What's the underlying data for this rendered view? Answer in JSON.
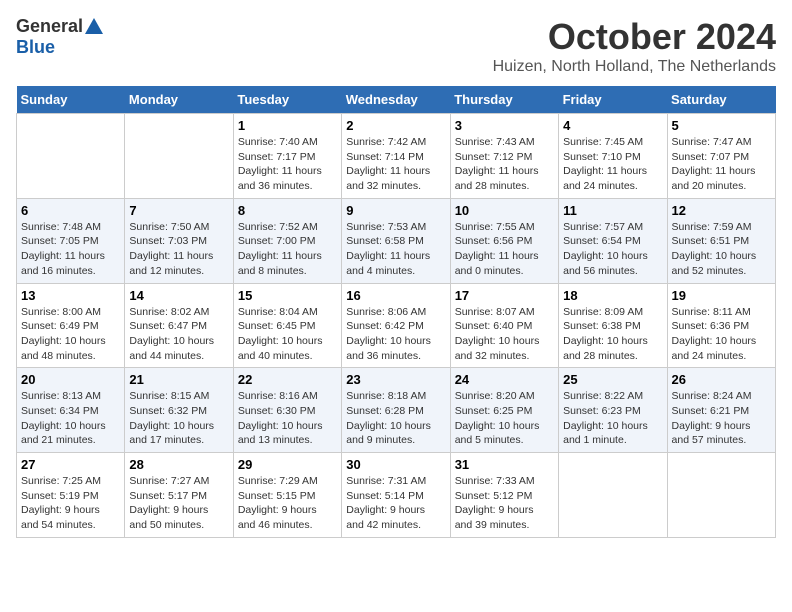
{
  "header": {
    "logo_general": "General",
    "logo_blue": "Blue",
    "title": "October 2024",
    "location": "Huizen, North Holland, The Netherlands"
  },
  "days_of_week": [
    "Sunday",
    "Monday",
    "Tuesday",
    "Wednesday",
    "Thursday",
    "Friday",
    "Saturday"
  ],
  "weeks": [
    [
      {
        "num": "",
        "detail": ""
      },
      {
        "num": "",
        "detail": ""
      },
      {
        "num": "1",
        "detail": "Sunrise: 7:40 AM\nSunset: 7:17 PM\nDaylight: 11 hours\nand 36 minutes."
      },
      {
        "num": "2",
        "detail": "Sunrise: 7:42 AM\nSunset: 7:14 PM\nDaylight: 11 hours\nand 32 minutes."
      },
      {
        "num": "3",
        "detail": "Sunrise: 7:43 AM\nSunset: 7:12 PM\nDaylight: 11 hours\nand 28 minutes."
      },
      {
        "num": "4",
        "detail": "Sunrise: 7:45 AM\nSunset: 7:10 PM\nDaylight: 11 hours\nand 24 minutes."
      },
      {
        "num": "5",
        "detail": "Sunrise: 7:47 AM\nSunset: 7:07 PM\nDaylight: 11 hours\nand 20 minutes."
      }
    ],
    [
      {
        "num": "6",
        "detail": "Sunrise: 7:48 AM\nSunset: 7:05 PM\nDaylight: 11 hours\nand 16 minutes."
      },
      {
        "num": "7",
        "detail": "Sunrise: 7:50 AM\nSunset: 7:03 PM\nDaylight: 11 hours\nand 12 minutes."
      },
      {
        "num": "8",
        "detail": "Sunrise: 7:52 AM\nSunset: 7:00 PM\nDaylight: 11 hours\nand 8 minutes."
      },
      {
        "num": "9",
        "detail": "Sunrise: 7:53 AM\nSunset: 6:58 PM\nDaylight: 11 hours\nand 4 minutes."
      },
      {
        "num": "10",
        "detail": "Sunrise: 7:55 AM\nSunset: 6:56 PM\nDaylight: 11 hours\nand 0 minutes."
      },
      {
        "num": "11",
        "detail": "Sunrise: 7:57 AM\nSunset: 6:54 PM\nDaylight: 10 hours\nand 56 minutes."
      },
      {
        "num": "12",
        "detail": "Sunrise: 7:59 AM\nSunset: 6:51 PM\nDaylight: 10 hours\nand 52 minutes."
      }
    ],
    [
      {
        "num": "13",
        "detail": "Sunrise: 8:00 AM\nSunset: 6:49 PM\nDaylight: 10 hours\nand 48 minutes."
      },
      {
        "num": "14",
        "detail": "Sunrise: 8:02 AM\nSunset: 6:47 PM\nDaylight: 10 hours\nand 44 minutes."
      },
      {
        "num": "15",
        "detail": "Sunrise: 8:04 AM\nSunset: 6:45 PM\nDaylight: 10 hours\nand 40 minutes."
      },
      {
        "num": "16",
        "detail": "Sunrise: 8:06 AM\nSunset: 6:42 PM\nDaylight: 10 hours\nand 36 minutes."
      },
      {
        "num": "17",
        "detail": "Sunrise: 8:07 AM\nSunset: 6:40 PM\nDaylight: 10 hours\nand 32 minutes."
      },
      {
        "num": "18",
        "detail": "Sunrise: 8:09 AM\nSunset: 6:38 PM\nDaylight: 10 hours\nand 28 minutes."
      },
      {
        "num": "19",
        "detail": "Sunrise: 8:11 AM\nSunset: 6:36 PM\nDaylight: 10 hours\nand 24 minutes."
      }
    ],
    [
      {
        "num": "20",
        "detail": "Sunrise: 8:13 AM\nSunset: 6:34 PM\nDaylight: 10 hours\nand 21 minutes."
      },
      {
        "num": "21",
        "detail": "Sunrise: 8:15 AM\nSunset: 6:32 PM\nDaylight: 10 hours\nand 17 minutes."
      },
      {
        "num": "22",
        "detail": "Sunrise: 8:16 AM\nSunset: 6:30 PM\nDaylight: 10 hours\nand 13 minutes."
      },
      {
        "num": "23",
        "detail": "Sunrise: 8:18 AM\nSunset: 6:28 PM\nDaylight: 10 hours\nand 9 minutes."
      },
      {
        "num": "24",
        "detail": "Sunrise: 8:20 AM\nSunset: 6:25 PM\nDaylight: 10 hours\nand 5 minutes."
      },
      {
        "num": "25",
        "detail": "Sunrise: 8:22 AM\nSunset: 6:23 PM\nDaylight: 10 hours\nand 1 minute."
      },
      {
        "num": "26",
        "detail": "Sunrise: 8:24 AM\nSunset: 6:21 PM\nDaylight: 9 hours\nand 57 minutes."
      }
    ],
    [
      {
        "num": "27",
        "detail": "Sunrise: 7:25 AM\nSunset: 5:19 PM\nDaylight: 9 hours\nand 54 minutes."
      },
      {
        "num": "28",
        "detail": "Sunrise: 7:27 AM\nSunset: 5:17 PM\nDaylight: 9 hours\nand 50 minutes."
      },
      {
        "num": "29",
        "detail": "Sunrise: 7:29 AM\nSunset: 5:15 PM\nDaylight: 9 hours\nand 46 minutes."
      },
      {
        "num": "30",
        "detail": "Sunrise: 7:31 AM\nSunset: 5:14 PM\nDaylight: 9 hours\nand 42 minutes."
      },
      {
        "num": "31",
        "detail": "Sunrise: 7:33 AM\nSunset: 5:12 PM\nDaylight: 9 hours\nand 39 minutes."
      },
      {
        "num": "",
        "detail": ""
      },
      {
        "num": "",
        "detail": ""
      }
    ]
  ]
}
